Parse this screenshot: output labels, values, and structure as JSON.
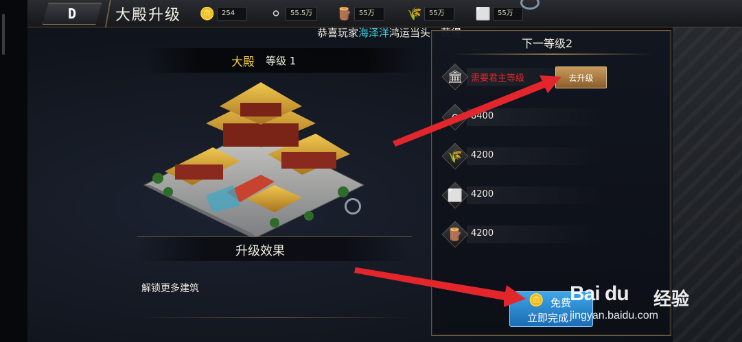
{
  "topbar": {
    "back_icon": "D",
    "title": "大殿升级",
    "resources": [
      {
        "icon": "gold-ingot-icon",
        "glyph": "🪙",
        "value": "254"
      },
      {
        "icon": "silver-coin-icon",
        "glyph": "⚪",
        "value": "55.5万"
      },
      {
        "icon": "wood-icon",
        "glyph": "🪵",
        "value": "55万"
      },
      {
        "icon": "food-icon",
        "glyph": "🌾",
        "value": "55万"
      },
      {
        "icon": "iron-icon",
        "glyph": "⬜",
        "value": "55万"
      }
    ]
  },
  "notice": {
    "prefix": "恭喜玩家",
    "player": "海泽洋",
    "suffix": "鸿运当头，获得"
  },
  "building": {
    "name": "大殿",
    "level_label": "等级 1",
    "effect_title": "升级效果",
    "effect_desc": "解锁更多建筑"
  },
  "panel": {
    "title": "下一等级2",
    "requirements": [
      {
        "icon": "lord-level-icon",
        "glyph": "🏛",
        "text": "需要君主等级",
        "status": "unmet"
      },
      {
        "icon": "silver-icon",
        "glyph": "⚪",
        "text": "8400",
        "status": "met"
      },
      {
        "icon": "food-icon",
        "glyph": "🌾",
        "text": "4200",
        "status": "met"
      },
      {
        "icon": "iron-icon",
        "glyph": "⬜",
        "text": "4200",
        "status": "met"
      },
      {
        "icon": "wood-icon",
        "glyph": "🪵",
        "text": "4200",
        "status": "met"
      }
    ],
    "go_upgrade_label": "去升级",
    "finish": {
      "top": "免费",
      "bottom": "立即完成"
    }
  },
  "watermark": {
    "logo": "Bai du",
    "cn": "经验",
    "url": "jingyan.baidu.com"
  },
  "colors": {
    "accent_gold": "#f2cc3c",
    "highlight": "#40d0e0",
    "warning": "#e0282a",
    "button_blue": "#2a86d0"
  }
}
